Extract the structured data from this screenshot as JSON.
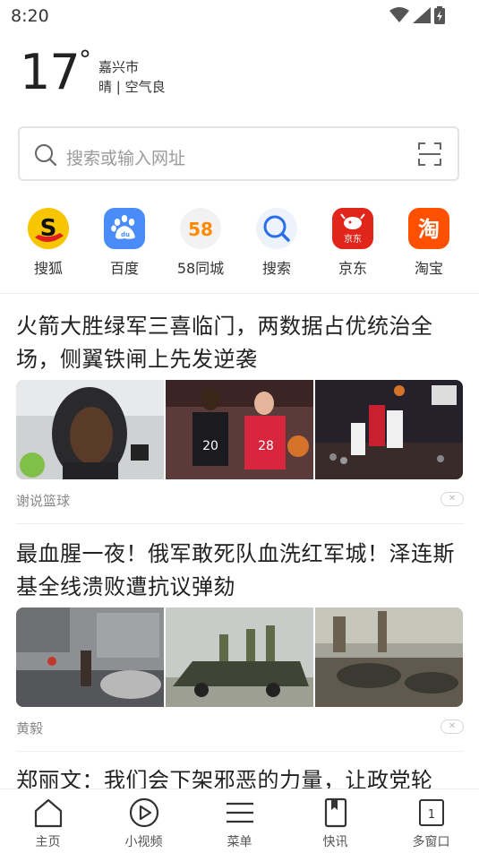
{
  "status": {
    "time": "8:20"
  },
  "weather": {
    "temperature": "17",
    "degree_symbol": "°",
    "city": "嘉兴市",
    "condition": "晴 | 空气良"
  },
  "search": {
    "placeholder": "搜索或输入网址"
  },
  "quick_links": [
    {
      "label": "搜狐",
      "icon": "sohu-icon",
      "color": "#f7c600"
    },
    {
      "label": "百度",
      "icon": "baidu-icon",
      "color": "#4a8cf7"
    },
    {
      "label": "58同城",
      "icon": "58-icon",
      "color": "#f2f2f2",
      "icon_text": "58"
    },
    {
      "label": "搜索",
      "icon": "search-app-icon",
      "color": "#eef3fb"
    },
    {
      "label": "京东",
      "icon": "jd-icon",
      "color": "#e1251b",
      "icon_text": "京东"
    },
    {
      "label": "淘宝",
      "icon": "taobao-icon",
      "color": "#ff5000",
      "icon_text": "淘"
    }
  ],
  "news": [
    {
      "title": "火箭大胜绿军三喜临门，两数据占优统治全场，侧翼铁闸上先发逆袭",
      "source": "谢说篮球"
    },
    {
      "title": "最血腥一夜！俄军敢死队血洗红军城！泽连斯基全线溃败遭抗议弹劾",
      "source": "黄毅"
    },
    {
      "title": "郑丽文：我们会下架邪恶的力量，让政党轮"
    }
  ],
  "bottom_nav": [
    {
      "label": "主页",
      "icon": "home-icon"
    },
    {
      "label": "小视频",
      "icon": "video-icon"
    },
    {
      "label": "菜单",
      "icon": "menu-icon"
    },
    {
      "label": "快讯",
      "icon": "bookmark-icon"
    },
    {
      "label": "多窗口",
      "icon": "windows-icon",
      "icon_text": "1"
    }
  ]
}
